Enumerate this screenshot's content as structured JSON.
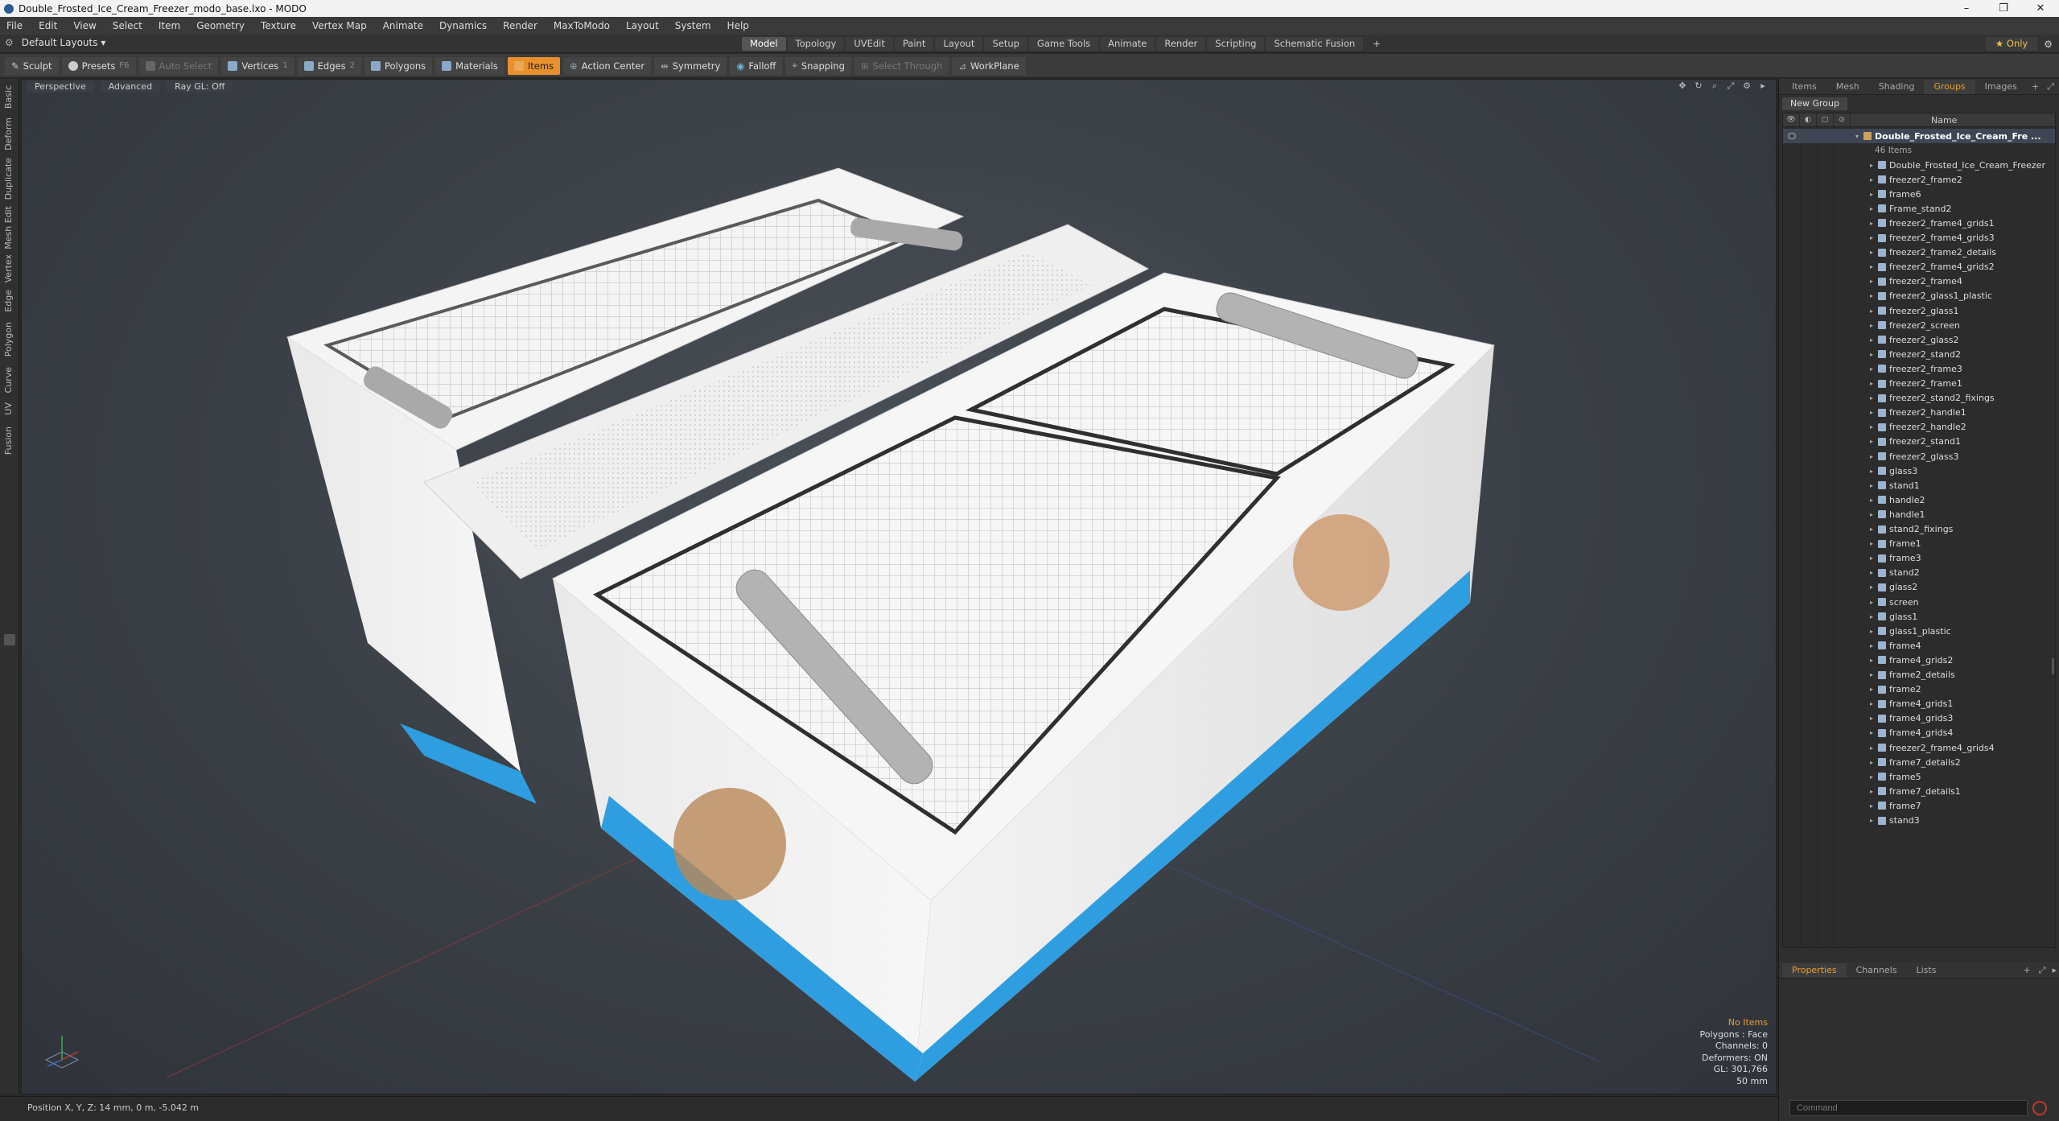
{
  "window": {
    "title": "Double_Frosted_Ice_Cream_Freezer_modo_base.lxo - MODO",
    "controls": [
      "–",
      "❐",
      "✕"
    ]
  },
  "menu": [
    "File",
    "Edit",
    "View",
    "Select",
    "Item",
    "Geometry",
    "Texture",
    "Vertex Map",
    "Animate",
    "Dynamics",
    "Render",
    "MaxToModo",
    "Layout",
    "System",
    "Help"
  ],
  "layouts": {
    "selected": "Default Layouts",
    "modes": [
      "Model",
      "Topology",
      "UVEdit",
      "Paint",
      "Layout",
      "Setup",
      "Game Tools",
      "Animate",
      "Render",
      "Scripting",
      "Schematic Fusion"
    ],
    "active_mode": "Model",
    "add": "+",
    "only": "Only"
  },
  "toolbar": {
    "sculpt": "Sculpt",
    "presets": "Presets",
    "presets_key": "F6",
    "auto_select": "Auto Select",
    "vertices": "Vertices",
    "vertices_key": "1",
    "edges": "Edges",
    "edges_key": "2",
    "polygons": "Polygons",
    "materials": "Materials",
    "items": "Items",
    "action_center": "Action Center",
    "symmetry": "Symmetry",
    "falloff": "Falloff",
    "snapping": "Snapping",
    "select_through": "Select Through",
    "workplane": "WorkPlane"
  },
  "left_tabs": [
    "Basic",
    "Deform",
    "Duplicate",
    "Mesh Edit",
    "Vertex",
    "Edge",
    "Polygon",
    "Curve",
    "UV",
    "Fusion"
  ],
  "viewport": {
    "view": "Perspective",
    "shading": "Advanced",
    "raygl": "Ray GL: Off",
    "info": {
      "selection": "No Items",
      "polygons": "Polygons : Face",
      "channels": "Channels: 0",
      "deformers": "Deformers: ON",
      "gl": "GL: 301,766",
      "size": "50 mm"
    }
  },
  "status": {
    "position": "Position X, Y, Z:   14 mm, 0 m, -5.042 m"
  },
  "right_panel": {
    "tabs": [
      "Items",
      "Mesh ...",
      "Shading",
      "Groups",
      "Images"
    ],
    "active_tab": "Groups",
    "new_group": "New Group",
    "column_name": "Name",
    "root": "Double_Frosted_Ice_Cream_Fre ...",
    "root_count": "46 Items",
    "items": [
      "Double_Frosted_Ice_Cream_Freezer",
      "freezer2_frame2",
      "frame6",
      "Frame_stand2",
      "freezer2_frame4_grids1",
      "freezer2_frame4_grids3",
      "freezer2_frame2_details",
      "freezer2_frame4_grids2",
      "freezer2_frame4",
      "freezer2_glass1_plastic",
      "freezer2_glass1",
      "freezer2_screen",
      "freezer2_glass2",
      "freezer2_stand2",
      "freezer2_frame3",
      "freezer2_frame1",
      "freezer2_stand2_fixings",
      "freezer2_handle1",
      "freezer2_handle2",
      "freezer2_stand1",
      "freezer2_glass3",
      "glass3",
      "stand1",
      "handle2",
      "handle1",
      "stand2_fixings",
      "frame1",
      "frame3",
      "stand2",
      "glass2",
      "screen",
      "glass1",
      "glass1_plastic",
      "frame4",
      "frame4_grids2",
      "frame2_details",
      "frame2",
      "frame4_grids1",
      "frame4_grids3",
      "frame4_grids4",
      "freezer2_frame4_grids4",
      "frame7_details2",
      "frame5",
      "frame7_details1",
      "frame7",
      "stand3"
    ],
    "props_tabs": [
      "Properties",
      "Channels",
      "Lists"
    ],
    "props_active": "Properties",
    "command_placeholder": "Command"
  }
}
